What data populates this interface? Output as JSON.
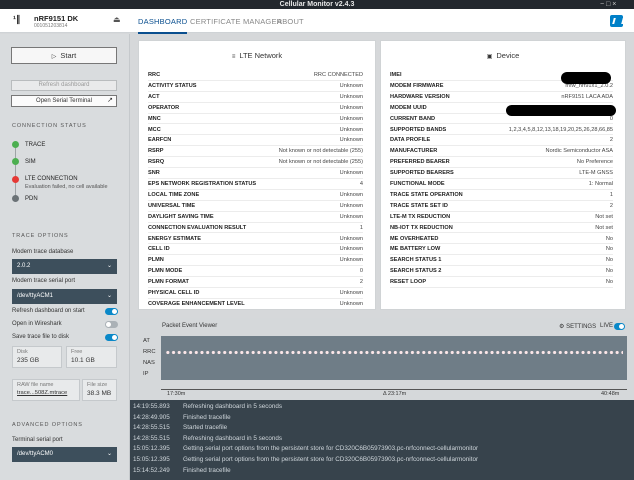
{
  "window": {
    "title": "Cellular Monitor v2.4.3",
    "controls": "−  □  ×"
  },
  "device": {
    "name": "nRF9151 DK",
    "serial": "001051203814",
    "icon": "¹∥"
  },
  "nav": {
    "tabs": [
      "DASHBOARD",
      "CERTIFICATE MANAGER",
      "ABOUT"
    ],
    "active": "DASHBOARD"
  },
  "sidebar": {
    "start_label": "Start",
    "refresh_label": "Refresh dashboard",
    "serial_terminal_label": "Open Serial Terminal",
    "connection_status_title": "CONNECTION STATUS",
    "connection": [
      {
        "label": "TRACE",
        "state": "ok"
      },
      {
        "label": "SIM",
        "state": "ok"
      },
      {
        "label": "LTE CONNECTION",
        "sub": "Evaluation failed, no cell available",
        "state": "error"
      },
      {
        "label": "PDN",
        "state": "off"
      }
    ],
    "trace_options_title": "TRACE OPTIONS",
    "modem_db_label": "Modem trace database",
    "modem_db_value": "2.0.2",
    "modem_port_label": "Modem trace serial port",
    "modem_port_value": "/dev/ttyACM1",
    "toggles": [
      {
        "label": "Refresh dashboard on start",
        "on": true
      },
      {
        "label": "Open in Wireshark",
        "on": false
      },
      {
        "label": "Save trace file to disk",
        "on": true
      }
    ],
    "disk_label": "Disk",
    "disk_value": "235 GB",
    "free_label": "Free",
    "free_value": "10.1 GB",
    "raw_label": "RAW file name",
    "raw_value": "trace...508Z.mtrace",
    "size_label": "File size",
    "size_value": "38.3 MB",
    "advanced_title": "ADVANCED OPTIONS",
    "terminal_port_label": "Terminal serial port",
    "terminal_port_value": "/dev/ttyACM0"
  },
  "lte": {
    "title": "LTE Network",
    "rows": [
      [
        "RRC",
        "RRC CONNECTED"
      ],
      [
        "ACTIVITY STATUS",
        "Unknown"
      ],
      [
        "ACT",
        "Unknown"
      ],
      [
        "OPERATOR",
        "Unknown"
      ],
      [
        "MNC",
        "Unknown"
      ],
      [
        "MCC",
        "Unknown"
      ],
      [
        "EARFCN",
        "Unknown"
      ],
      [
        "RSRP",
        "Not known or not detectable (255)"
      ],
      [
        "RSRQ",
        "Not known or not detectable (255)"
      ],
      [
        "SNR",
        "Unknown"
      ],
      [
        "EPS NETWORK REGISTRATION STATUS",
        "4"
      ],
      [
        "LOCAL TIME ZONE",
        "Unknown"
      ],
      [
        "UNIVERSAL TIME",
        "Unknown"
      ],
      [
        "DAYLIGHT SAVING TIME",
        "Unknown"
      ],
      [
        "CONNECTION EVALUATION RESULT",
        "1"
      ],
      [
        "ENERGY ESTIMATE",
        "Unknown"
      ],
      [
        "CELL ID",
        "Unknown"
      ],
      [
        "PLMN",
        "Unknown"
      ],
      [
        "PLMN MODE",
        "0"
      ],
      [
        "PLMN FORMAT",
        "2"
      ],
      [
        "PHYSICAL CELL ID",
        "Unknown"
      ],
      [
        "COVERAGE ENHANCEMENT LEVEL",
        "Unknown"
      ]
    ]
  },
  "device_panel": {
    "title": "Device",
    "rows": [
      [
        "IMEI",
        ""
      ],
      [
        "MODEM FIRMWARE",
        "mfw_nrf91x1_2.0.2"
      ],
      [
        "HARDWARE VERSION",
        "nRF9151 LACA ADA"
      ],
      [
        "MODEM UUID",
        ""
      ],
      [
        "CURRENT BAND",
        "0"
      ],
      [
        "SUPPORTED BANDS",
        "1,2,3,4,5,8,12,13,18,19,20,25,26,28,66,85"
      ],
      [
        "DATA PROFILE",
        "2"
      ],
      [
        "MANUFACTURER",
        "Nordic Semiconductor ASA"
      ],
      [
        "PREFERRED BEARER",
        "No Preference"
      ],
      [
        "SUPPORTED BEARERS",
        "LTE-M GNSS"
      ],
      [
        "FUNCTIONAL MODE",
        "1: Normal"
      ],
      [
        "TRACE STATE OPERATION",
        "1"
      ],
      [
        "TRACE STATE SET ID",
        "2"
      ],
      [
        "LTE-M TX REDUCTION",
        "Not set"
      ],
      [
        "NB-IOT TX REDUCTION",
        "Not set"
      ],
      [
        "ME OVERHEATED",
        "No"
      ],
      [
        "ME BATTERY LOW",
        "No"
      ],
      [
        "SEARCH STATUS 1",
        "No"
      ],
      [
        "SEARCH STATUS 2",
        "No"
      ],
      [
        "RESET LOOP",
        "No"
      ]
    ]
  },
  "packet_viewer": {
    "title": "Packet Event Viewer",
    "settings_label": "SETTINGS",
    "live_label": "LIVE",
    "live_on": true,
    "lanes": [
      "AT",
      "RRC",
      "NAS",
      "IP"
    ],
    "ticks": [
      "17:30m",
      "Δ 23:17m",
      "40:48m"
    ]
  },
  "log": [
    [
      "14:19:55.893",
      "Refreshing dashboard in 5 seconds"
    ],
    [
      "14:28:49.905",
      "Finished tracefile"
    ],
    [
      "14:28:55.515",
      "Started tracefile"
    ],
    [
      "14:28:55.515",
      "Refreshing dashboard in 5 seconds"
    ],
    [
      "15:05:12.395",
      "Getting serial port options from the persistent store for CD320C6B05973903.pc-nrfconnect-cellularmonitor"
    ],
    [
      "15:05:12.395",
      "Getting serial port options from the persistent store for CD320C6B05973903.pc-nrfconnect-cellularmonitor"
    ],
    [
      "15:14:52.249",
      "Finished tracefile"
    ]
  ],
  "colors": {
    "accent": "#0a4f8f",
    "ok": "#4caf50",
    "error": "#e53935",
    "log_bg": "#37434c"
  }
}
